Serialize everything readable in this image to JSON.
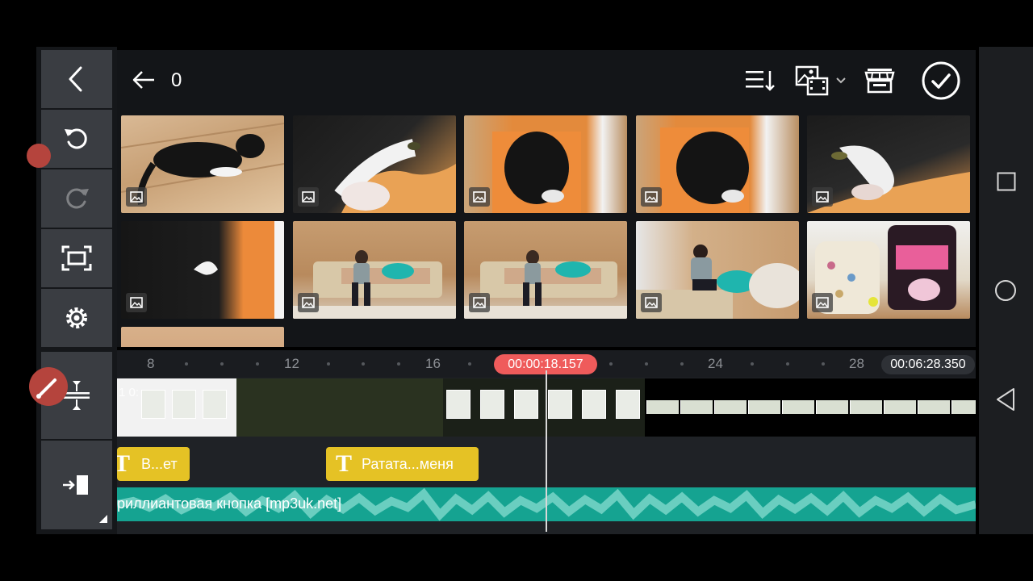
{
  "header": {
    "selected_count": "0"
  },
  "icons": {
    "back": "chevron-left-icon",
    "undo": "undo-icon",
    "redo": "redo-icon",
    "fullscreen": "fullscreen-icon",
    "settings": "gear-icon",
    "split": "split-icon",
    "export": "export-icon",
    "sort": "sort-icon",
    "media_type": "media-type-icon",
    "store": "store-icon",
    "confirm": "check-circle-icon"
  },
  "timeline": {
    "ruler_labels": [
      "8",
      "12",
      "16",
      "24",
      "28"
    ],
    "playhead_time": "00:00:18.157",
    "total_time": "00:06:28.350",
    "clip_label": "1 0:",
    "text_clips": [
      "В...ет",
      "Ратата...меня"
    ],
    "audio_label": "риллиантовая кнопка [mp3uk.net]"
  },
  "colors": {
    "accent_red": "#ef5b5b",
    "text_clip": "#e5c225",
    "audio": "#15a391"
  }
}
